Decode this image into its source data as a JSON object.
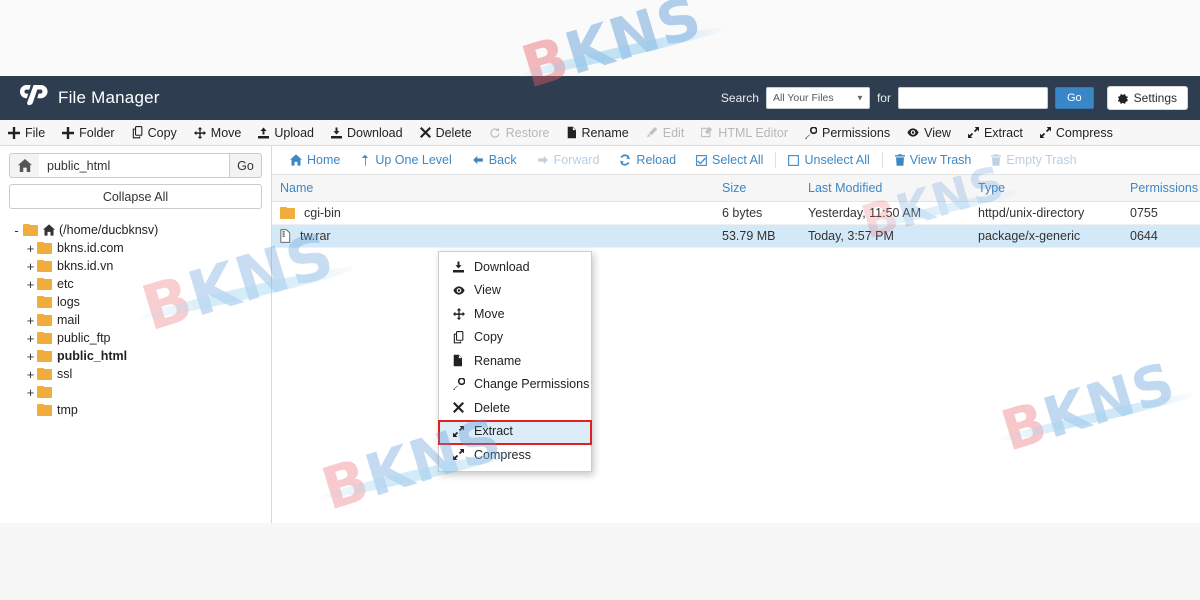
{
  "header": {
    "app_title": "File Manager",
    "logo": "cpanel-logo",
    "search_label": "Search",
    "search_scope": "All Your Files",
    "for_label": "for",
    "search_value": "",
    "search_placeholder": "",
    "go_label": "Go",
    "settings_label": "Settings",
    "bg_color": "#2e3e50"
  },
  "toolbar": {
    "items": [
      {
        "label": "File",
        "icon": "plus-icon",
        "disabled": false
      },
      {
        "label": "Folder",
        "icon": "plus-icon",
        "disabled": false
      },
      {
        "label": "Copy",
        "icon": "copy-icon",
        "disabled": false
      },
      {
        "label": "Move",
        "icon": "move-icon",
        "disabled": false
      },
      {
        "label": "Upload",
        "icon": "upload-icon",
        "disabled": false
      },
      {
        "label": "Download",
        "icon": "download-icon",
        "disabled": false
      },
      {
        "label": "Delete",
        "icon": "x-icon",
        "disabled": false
      },
      {
        "label": "Restore",
        "icon": "restore-icon",
        "disabled": true
      },
      {
        "label": "Rename",
        "icon": "file-icon",
        "disabled": false
      },
      {
        "label": "Edit",
        "icon": "pencil-icon",
        "disabled": true
      },
      {
        "label": "HTML Editor",
        "icon": "html-editor-icon",
        "disabled": true
      },
      {
        "label": "Permissions",
        "icon": "key-icon",
        "disabled": false
      },
      {
        "label": "View",
        "icon": "eye-icon",
        "disabled": false
      },
      {
        "label": "Extract",
        "icon": "extract-icon",
        "disabled": false
      },
      {
        "label": "Compress",
        "icon": "compress-icon",
        "disabled": false
      }
    ]
  },
  "sidebar": {
    "home_icon": "home-icon",
    "path_value": "public_html",
    "path_placeholder": "",
    "go_label": "Go",
    "collapse_all_label": "Collapse All",
    "tree": [
      {
        "label": "(/home/ducbknsv)",
        "toggle": "-",
        "depth": 0,
        "root": true,
        "current": false
      },
      {
        "label": "bkns.id.com",
        "toggle": "+",
        "depth": 1,
        "root": false,
        "current": false
      },
      {
        "label": "bkns.id.vn",
        "toggle": "+",
        "depth": 1,
        "root": false,
        "current": false
      },
      {
        "label": "etc",
        "toggle": "+",
        "depth": 1,
        "root": false,
        "current": false
      },
      {
        "label": "logs",
        "toggle": "",
        "depth": 1,
        "root": false,
        "current": false
      },
      {
        "label": "mail",
        "toggle": "+",
        "depth": 1,
        "root": false,
        "current": false
      },
      {
        "label": "public_ftp",
        "toggle": "+",
        "depth": 1,
        "root": false,
        "current": false
      },
      {
        "label": "public_html",
        "toggle": "+",
        "depth": 1,
        "root": false,
        "current": true
      },
      {
        "label": "ssl",
        "toggle": "+",
        "depth": 1,
        "root": false,
        "current": false
      },
      {
        "label": "",
        "toggle": "+",
        "depth": 1,
        "root": false,
        "current": false
      },
      {
        "label": "tmp",
        "toggle": "",
        "depth": 1,
        "root": false,
        "current": false
      }
    ]
  },
  "pane": {
    "nav": [
      {
        "label": "Home",
        "icon": "home-icon",
        "disabled": false
      },
      {
        "label": "Up One Level",
        "icon": "up-arrow-icon",
        "disabled": false
      },
      {
        "label": "Back",
        "icon": "left-arrow-icon",
        "disabled": false
      },
      {
        "label": "Forward",
        "icon": "right-arrow-icon",
        "disabled": true
      },
      {
        "label": "Reload",
        "icon": "reload-icon",
        "disabled": false
      },
      {
        "label": "Select All",
        "icon": "checkbox-checked-icon",
        "disabled": false
      },
      {
        "label": "Unselect All",
        "icon": "checkbox-empty-icon",
        "disabled": false
      },
      {
        "label": "View Trash",
        "icon": "trash-icon",
        "disabled": false
      },
      {
        "label": "Empty Trash",
        "icon": "trash-icon",
        "disabled": true
      }
    ],
    "columns": [
      "Name",
      "Size",
      "Last Modified",
      "Type",
      "Permissions"
    ],
    "rows": [
      {
        "icon": "folder-icon",
        "name": "cgi-bin",
        "size": "6 bytes",
        "modified": "Yesterday, 11:50 AM",
        "type": "httpd/unix-directory",
        "permissions": "0755",
        "selected": false
      },
      {
        "icon": "archive-file-icon",
        "name": "tw.rar",
        "size": "53.79 MB",
        "modified": "Today, 3:57 PM",
        "type": "package/x-generic",
        "permissions": "0644",
        "selected": true
      }
    ],
    "selected_row_color": "#d4e9f7"
  },
  "context_menu": {
    "items": [
      {
        "label": "Download",
        "icon": "download-icon",
        "highlighted": false
      },
      {
        "label": "View",
        "icon": "eye-icon",
        "highlighted": false
      },
      {
        "label": "Move",
        "icon": "move-icon",
        "highlighted": false
      },
      {
        "label": "Copy",
        "icon": "copy-icon",
        "highlighted": false
      },
      {
        "label": "Rename",
        "icon": "file-icon",
        "highlighted": false
      },
      {
        "label": "Change Permissions",
        "icon": "key-icon",
        "highlighted": false
      },
      {
        "label": "Delete",
        "icon": "x-icon",
        "highlighted": false
      },
      {
        "label": "Extract",
        "icon": "extract-icon",
        "highlighted": true
      },
      {
        "label": "Compress",
        "icon": "compress-icon",
        "highlighted": false
      }
    ],
    "highlight_border_color": "#e32020",
    "highlight_bg_color": "#dcecf8"
  },
  "watermarks": [
    {
      "text_b": "B",
      "text_kns": "KNS"
    },
    {
      "text_b": "B",
      "text_kns": "KNS"
    },
    {
      "text_b": "B",
      "text_kns": "KNS"
    },
    {
      "text_b": "B",
      "text_kns": "KNS"
    },
    {
      "text_b": "B",
      "text_kns": "KNS"
    }
  ]
}
